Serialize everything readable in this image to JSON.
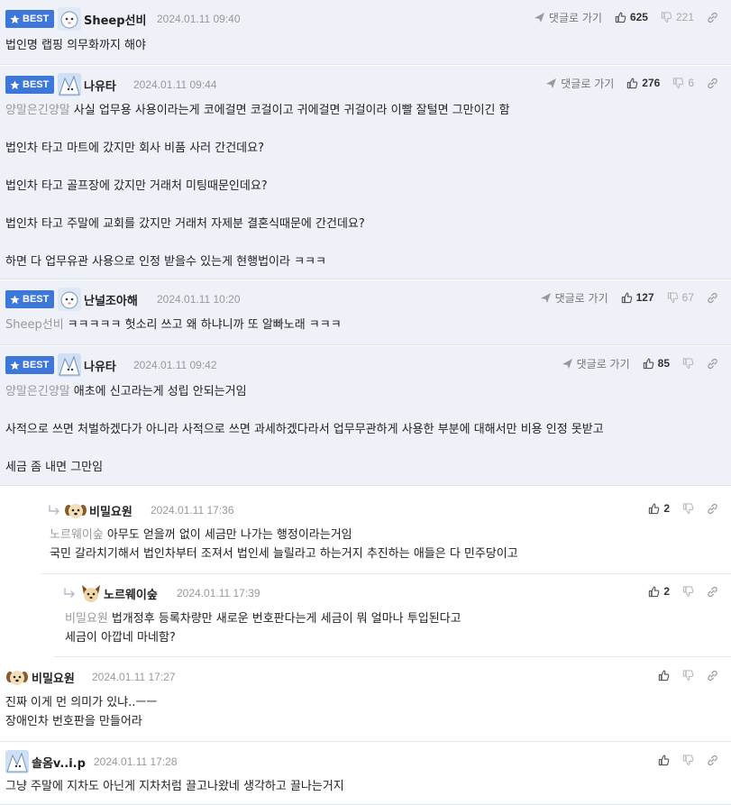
{
  "labels": {
    "best": "BEST",
    "reply_link": "댓글로 가기"
  },
  "colors": {
    "best_bg": "#eef1f7",
    "badge": "#3d77d9",
    "mention": "#999999"
  },
  "comments": [
    {
      "best": true,
      "avatar": "sheep-avatar-icon",
      "nick": "Sheep선비",
      "date": "2024.01.11 09:40",
      "show_reply_link": true,
      "up": "625",
      "down": "221",
      "mention": "",
      "lines": [
        "법인명 랩핑 의무화까지 해야"
      ]
    },
    {
      "best": true,
      "avatar": "ice-avatar-icon",
      "nick": "나유타",
      "date": "2024.01.11 09:44",
      "show_reply_link": true,
      "up": "276",
      "down": "6",
      "mention": "양말은긴양말",
      "lines": [
        "사실 업무용 사용이라는게 코에걸면 코걸이고 귀에걸면 귀걸이라 이빨 잘털면 그만이긴 함",
        "",
        "법인차 타고 마트에 갔지만 회사 비품 사러 간건데요?",
        "",
        "법인차 타고 골프장에 갔지만 거래처 미팅때문인데요?",
        "",
        "법인차 타고 주말에 교회를 갔지만 거래처 자제분 결혼식때문에 간건데요?",
        "",
        "하면 다 업무유관 사용으로 인정 받을수 있는게 현행법이라 ㅋㅋㅋ"
      ]
    },
    {
      "best": true,
      "avatar": "sheep-avatar-icon",
      "nick": "난널조아해",
      "date": "2024.01.11 10:20",
      "show_reply_link": true,
      "up": "127",
      "down": "67",
      "mention": "Sheep선비",
      "lines": [
        "ㅋㅋㅋㅋㅋ 헛소리 쓰고 왜 하냐니까 또 알빠노래 ㅋㅋㅋ"
      ]
    },
    {
      "best": true,
      "avatar": "ice-avatar-icon",
      "nick": "나유타",
      "date": "2024.01.11 09:42",
      "show_reply_link": true,
      "up": "85",
      "down": "",
      "mention": "양말은긴양말",
      "lines": [
        "애초에 신고라는게 성립 안되는거임",
        "",
        "사적으로 쓰면 처벌하겠다가 아니라 사적으로 쓰면 과세하겠다라서 업무무관하게 사용한 부분에 대해서만 비용 인정 못받고",
        "",
        "세금 좀 내면 그만임"
      ]
    },
    {
      "best": false,
      "reply": 1,
      "avatar": "dog-avatar-icon",
      "nick": "비밀요원",
      "date": "2024.01.11 17:36",
      "show_reply_link": false,
      "up": "2",
      "down": "",
      "mention": "노르웨이숲",
      "lines": [
        "아무도 얻을꺼 없이 세금만 나가는 행정이라는거임",
        "국민 갈라치기해서 법인차부터 조져서 법인세 늘릴라고 하는거지 추진하는 애들은 다 민주당이고"
      ]
    },
    {
      "best": false,
      "reply": 2,
      "avatar": "cat-avatar-icon",
      "nick": "노르웨이숲",
      "date": "2024.01.11 17:39",
      "show_reply_link": false,
      "up": "2",
      "down": "",
      "mention": "비밀요원",
      "lines": [
        "법개정후 등록차량만 새로운 번호판다는게 세금이 뭐 얼마나 투입된다고",
        "세금이 아깝네 마네함?"
      ]
    },
    {
      "best": false,
      "reply": 0,
      "avatar": "dog-avatar-icon",
      "nick": "비밀요원",
      "date": "2024.01.11 17:27",
      "show_reply_link": false,
      "up": "",
      "down": "",
      "mention": "",
      "lines": [
        "진짜 이게 먼 의미가 있냐..ㅡㅡ",
        "장애인차 번호판을 만들어라"
      ]
    },
    {
      "best": false,
      "reply": 0,
      "avatar": "ice-avatar-icon",
      "nick": "솔옴v..i.p",
      "date": "2024.01.11 17:28",
      "show_reply_link": false,
      "up": "",
      "down": "",
      "mention": "",
      "lines": [
        "그냥 주말에 지차도 아닌게 지차처럼 끌고나왔네 생각하고 끌나는거지"
      ]
    }
  ]
}
